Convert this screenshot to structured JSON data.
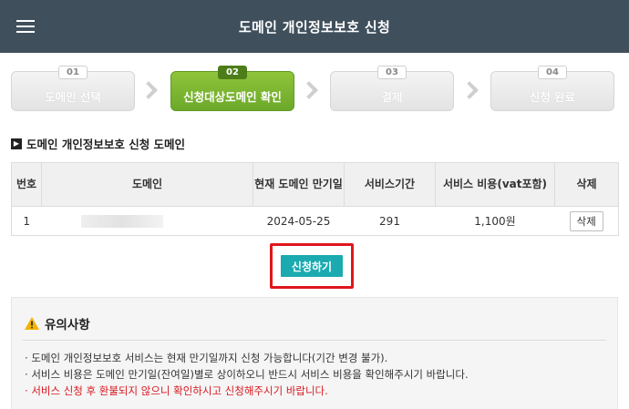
{
  "header": {
    "title": "도메인 개인정보보호 신청",
    "menu_icon": "hamburger-menu-icon"
  },
  "steps": [
    {
      "num": "01",
      "label": "도메인 선택",
      "active": false
    },
    {
      "num": "02",
      "label": "신청대상도메인 확인",
      "active": true
    },
    {
      "num": "03",
      "label": "결제",
      "active": false
    },
    {
      "num": "04",
      "label": "신청 완료",
      "active": false
    }
  ],
  "section": {
    "title": "도메인 개인정보보호 신청 도메인"
  },
  "table": {
    "headers": [
      "번호",
      "도메인",
      "현재 도메인 만기일",
      "서비스기간",
      "서비스 비용(vat포함)",
      "삭제"
    ],
    "rows": [
      {
        "no": "1",
        "domain": "",
        "expiry": "2024-05-25",
        "period": "291",
        "cost": "1,100원",
        "delete_label": "삭제"
      }
    ]
  },
  "apply_button": {
    "label": "신청하기"
  },
  "notice": {
    "title": "유의사항",
    "items": [
      "도메인 개인정보보호 서비스는 현재 만기일까지 신청 가능합니다(기간 변경 불가).",
      "서비스 비용은 도메인 만기일(잔여일)별로 상이하오니 반드시 서비스 비용을 확인해주시기 바랍니다.",
      "서비스 신청 후 환불되지 않으니 확인하시고 신청해주시기 바랍니다."
    ]
  },
  "colors": {
    "header_bg": "#3f4f5c",
    "active_step": "#7ab532",
    "apply_button": "#1aaab0",
    "highlight_border": "#e0161d",
    "warning_text": "#d71920"
  }
}
